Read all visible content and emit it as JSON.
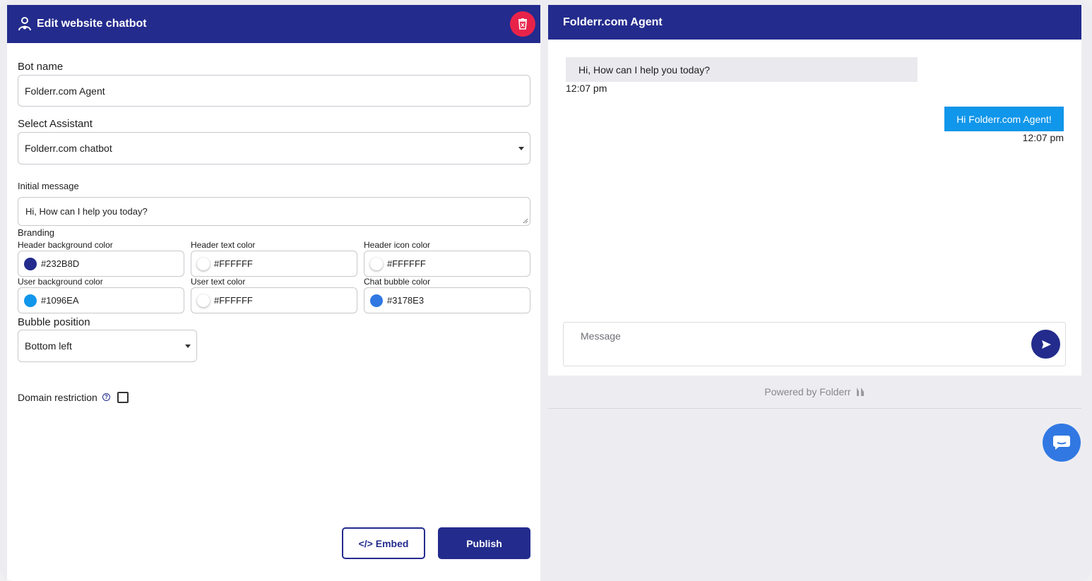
{
  "editor": {
    "title": "Edit website chatbot",
    "bot_name_label": "Bot name",
    "bot_name_value": "Folderr.com Agent",
    "assistant_label": "Select Assistant",
    "assistant_value": "Folderr.com chatbot",
    "initial_message_label": "Initial message",
    "initial_message_value": "Hi, How can I help you today?",
    "branding_label": "Branding",
    "colors": [
      {
        "label": "Header background color",
        "value": "#232B8D"
      },
      {
        "label": "Header text color",
        "value": "#FFFFFF"
      },
      {
        "label": "Header icon color",
        "value": "#FFFFFF"
      },
      {
        "label": "User background color",
        "value": "#1096EA"
      },
      {
        "label": "User text color",
        "value": "#FFFFFF"
      },
      {
        "label": "Chat bubble color",
        "value": "#3178E3"
      }
    ],
    "bubble_position_label": "Bubble position",
    "bubble_position_value": "Bottom left",
    "domain_restriction_label": "Domain restriction",
    "embed_label": "</> Embed",
    "publish_label": "Publish"
  },
  "preview": {
    "title": "Folderr.com Agent",
    "messages": [
      {
        "sender": "bot",
        "text": "Hi, How can I help you today?",
        "time": "12:07 pm"
      },
      {
        "sender": "user",
        "text": "Hi Folderr.com Agent!",
        "time": "12:07 pm"
      }
    ],
    "message_placeholder": "Message",
    "powered_by": "Powered by Folderr"
  },
  "theme": {
    "header_bg": "#232B8D",
    "user_bg": "#1096EA",
    "bubble": "#3178E3",
    "danger": "#e8234a"
  }
}
